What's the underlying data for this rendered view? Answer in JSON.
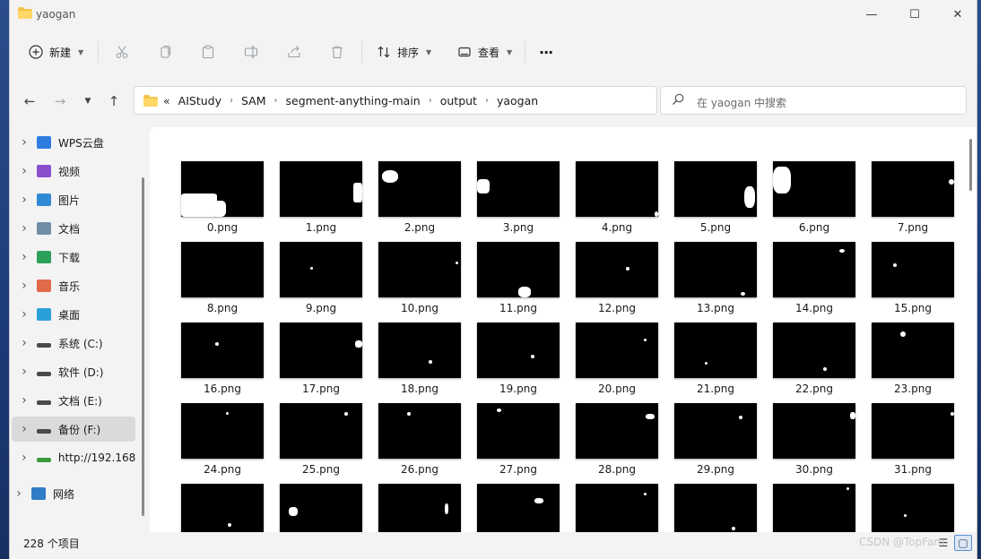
{
  "window": {
    "title": "yaogan",
    "controls": {
      "minimize": "—",
      "maximize": "☐",
      "close": "✕"
    }
  },
  "toolbar": {
    "new_label": "新建",
    "sort_label": "排序",
    "view_label": "查看",
    "more_label": "···"
  },
  "address": {
    "overflow": "«",
    "crumbs": [
      "AIStudy",
      "SAM",
      "segment-anything-main",
      "output",
      "yaogan"
    ]
  },
  "search": {
    "placeholder": "在 yaogan 中搜索"
  },
  "sidebar": {
    "items": [
      {
        "label": "WPS云盘",
        "icon": "cloud-icon",
        "color": "#2e7de0"
      },
      {
        "label": "视频",
        "icon": "video-icon",
        "color": "#8a4fcf"
      },
      {
        "label": "图片",
        "icon": "pictures-icon",
        "color": "#2f8ad6"
      },
      {
        "label": "文档",
        "icon": "documents-icon",
        "color": "#6f8ea8"
      },
      {
        "label": "下载",
        "icon": "download-icon",
        "color": "#2ba05b"
      },
      {
        "label": "音乐",
        "icon": "music-icon",
        "color": "#e06a4a"
      },
      {
        "label": "桌面",
        "icon": "desktop-icon",
        "color": "#2b9fd8"
      },
      {
        "label": "系统 (C:)",
        "icon": "drive-icon",
        "color": "#4a4a4a"
      },
      {
        "label": "软件 (D:)",
        "icon": "drive-icon",
        "color": "#4a4a4a"
      },
      {
        "label": "文档 (E:)",
        "icon": "drive-icon",
        "color": "#4a4a4a"
      },
      {
        "label": "备份 (F:)",
        "icon": "drive-icon",
        "color": "#4a4a4a"
      },
      {
        "label": "http://192.168",
        "icon": "network-drive-icon",
        "color": "#3a9a3a"
      },
      {
        "label": "网络",
        "icon": "network-icon",
        "color": "#2f7cc7"
      }
    ]
  },
  "files": [
    "0.png",
    "1.png",
    "2.png",
    "3.png",
    "4.png",
    "5.png",
    "6.png",
    "7.png",
    "8.png",
    "9.png",
    "10.png",
    "11.png",
    "12.png",
    "13.png",
    "14.png",
    "15.png",
    "16.png",
    "17.png",
    "18.png",
    "19.png",
    "20.png",
    "21.png",
    "22.png",
    "23.png",
    "24.png",
    "25.png",
    "26.png",
    "27.png",
    "28.png",
    "29.png",
    "30.png",
    "31.png",
    "",
    "",
    "",
    "",
    "",
    "",
    "",
    ""
  ],
  "status": {
    "count": "228 个项目"
  },
  "watermark": "CSDN @TopFam"
}
